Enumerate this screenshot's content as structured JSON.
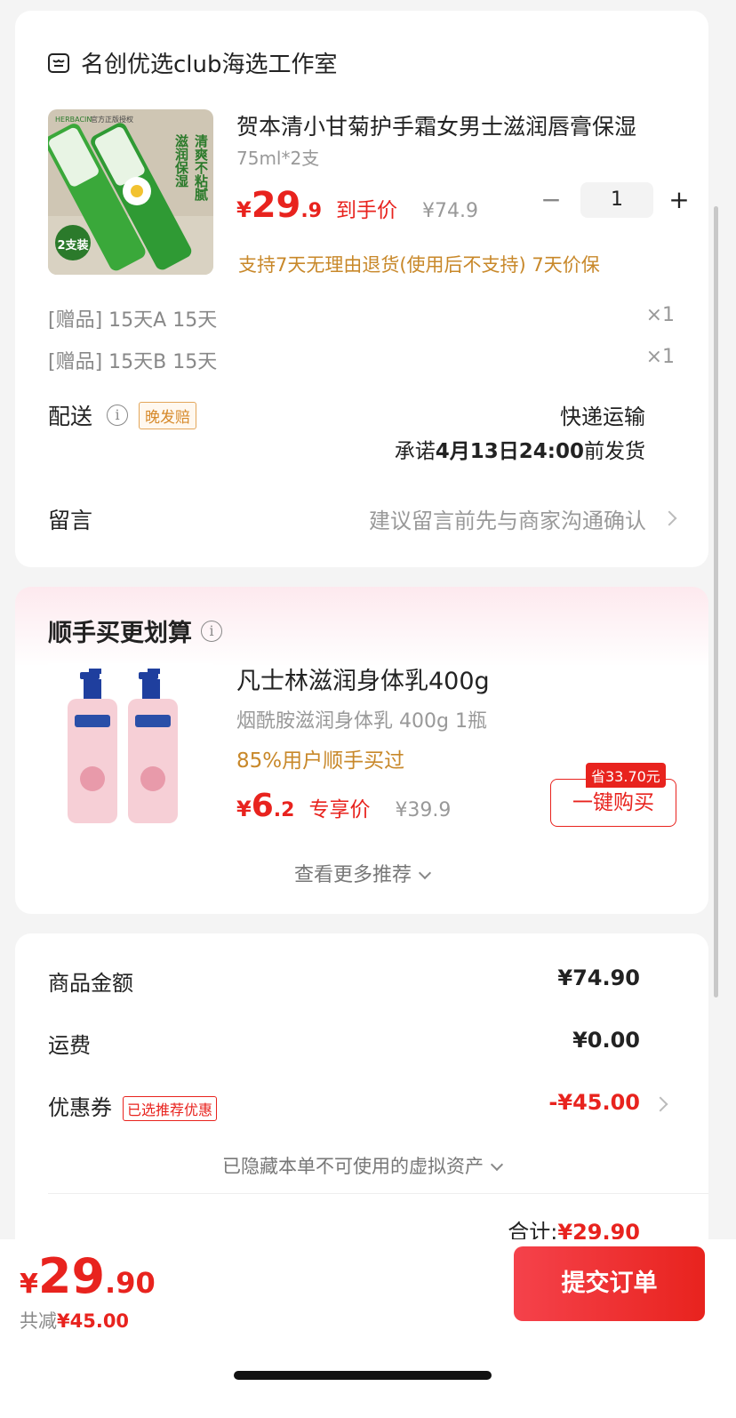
{
  "shop": {
    "name": "名创优选club海选工作室",
    "icon": "store-icon"
  },
  "product": {
    "title": "贺本清小甘菊护手霜女男士滋润唇膏保湿",
    "spec": "75ml*2支",
    "price_symbol": "¥",
    "price_int": "29",
    "price_dec": ".9",
    "price_tag": "到手价",
    "original_price": "¥74.9",
    "quantity": "1",
    "minus": "−",
    "plus": "+",
    "return_note": "支持7天无理由退货(使用后不支持)  7天价保",
    "image_text": {
      "brand": "HERBACIN",
      "auth": "官方正版授权",
      "line1": "滋润保湿",
      "line2": "清爽不粘腻",
      "badge": "2支装"
    }
  },
  "gifts": [
    {
      "label": "[赠品]  15天A 15天",
      "qty": "×1"
    },
    {
      "label": "[赠品]  15天B 15天",
      "qty": "×1"
    }
  ],
  "shipping": {
    "label": "配送",
    "late_badge": "晚发赔",
    "method": "快递运输",
    "promise_prefix": "承诺",
    "promise_time": "4月13日24:00",
    "promise_suffix": "前发货"
  },
  "message": {
    "label": "留言",
    "hint": "建议留言前先与商家沟通确认"
  },
  "recommend": {
    "title": "顺手买更划算",
    "item_title": "凡士林滋润身体乳400g",
    "item_spec": "烟酰胺滋润身体乳 400g 1瓶",
    "item_users": "85%用户顺手买过",
    "price_symbol": "¥",
    "price_int": "6",
    "price_dec": ".2",
    "price_tag": "专享价",
    "original_price": "¥39.9",
    "save_badge": "省33.70元",
    "buy_button": "一键购买",
    "more": "查看更多推荐"
  },
  "summary": {
    "goods_label": "商品金额",
    "goods_value": "¥74.90",
    "freight_label": "运费",
    "freight_value": "¥0.00",
    "coupon_label": "优惠券",
    "coupon_badge": "已选推荐优惠",
    "coupon_value": "-¥45.00",
    "hidden_assets": "已隐藏本单不可使用的虚拟资产",
    "total_label": "合计:",
    "total_value": "¥29.90"
  },
  "bottom": {
    "symbol": "¥",
    "int": "29",
    "dec": ".90",
    "saved_label": "共减",
    "saved_value": "¥45.00",
    "submit": "提交订单"
  },
  "colors": {
    "accent": "#e8231e",
    "gold": "#c8882a",
    "background": "#f4f4f4"
  }
}
